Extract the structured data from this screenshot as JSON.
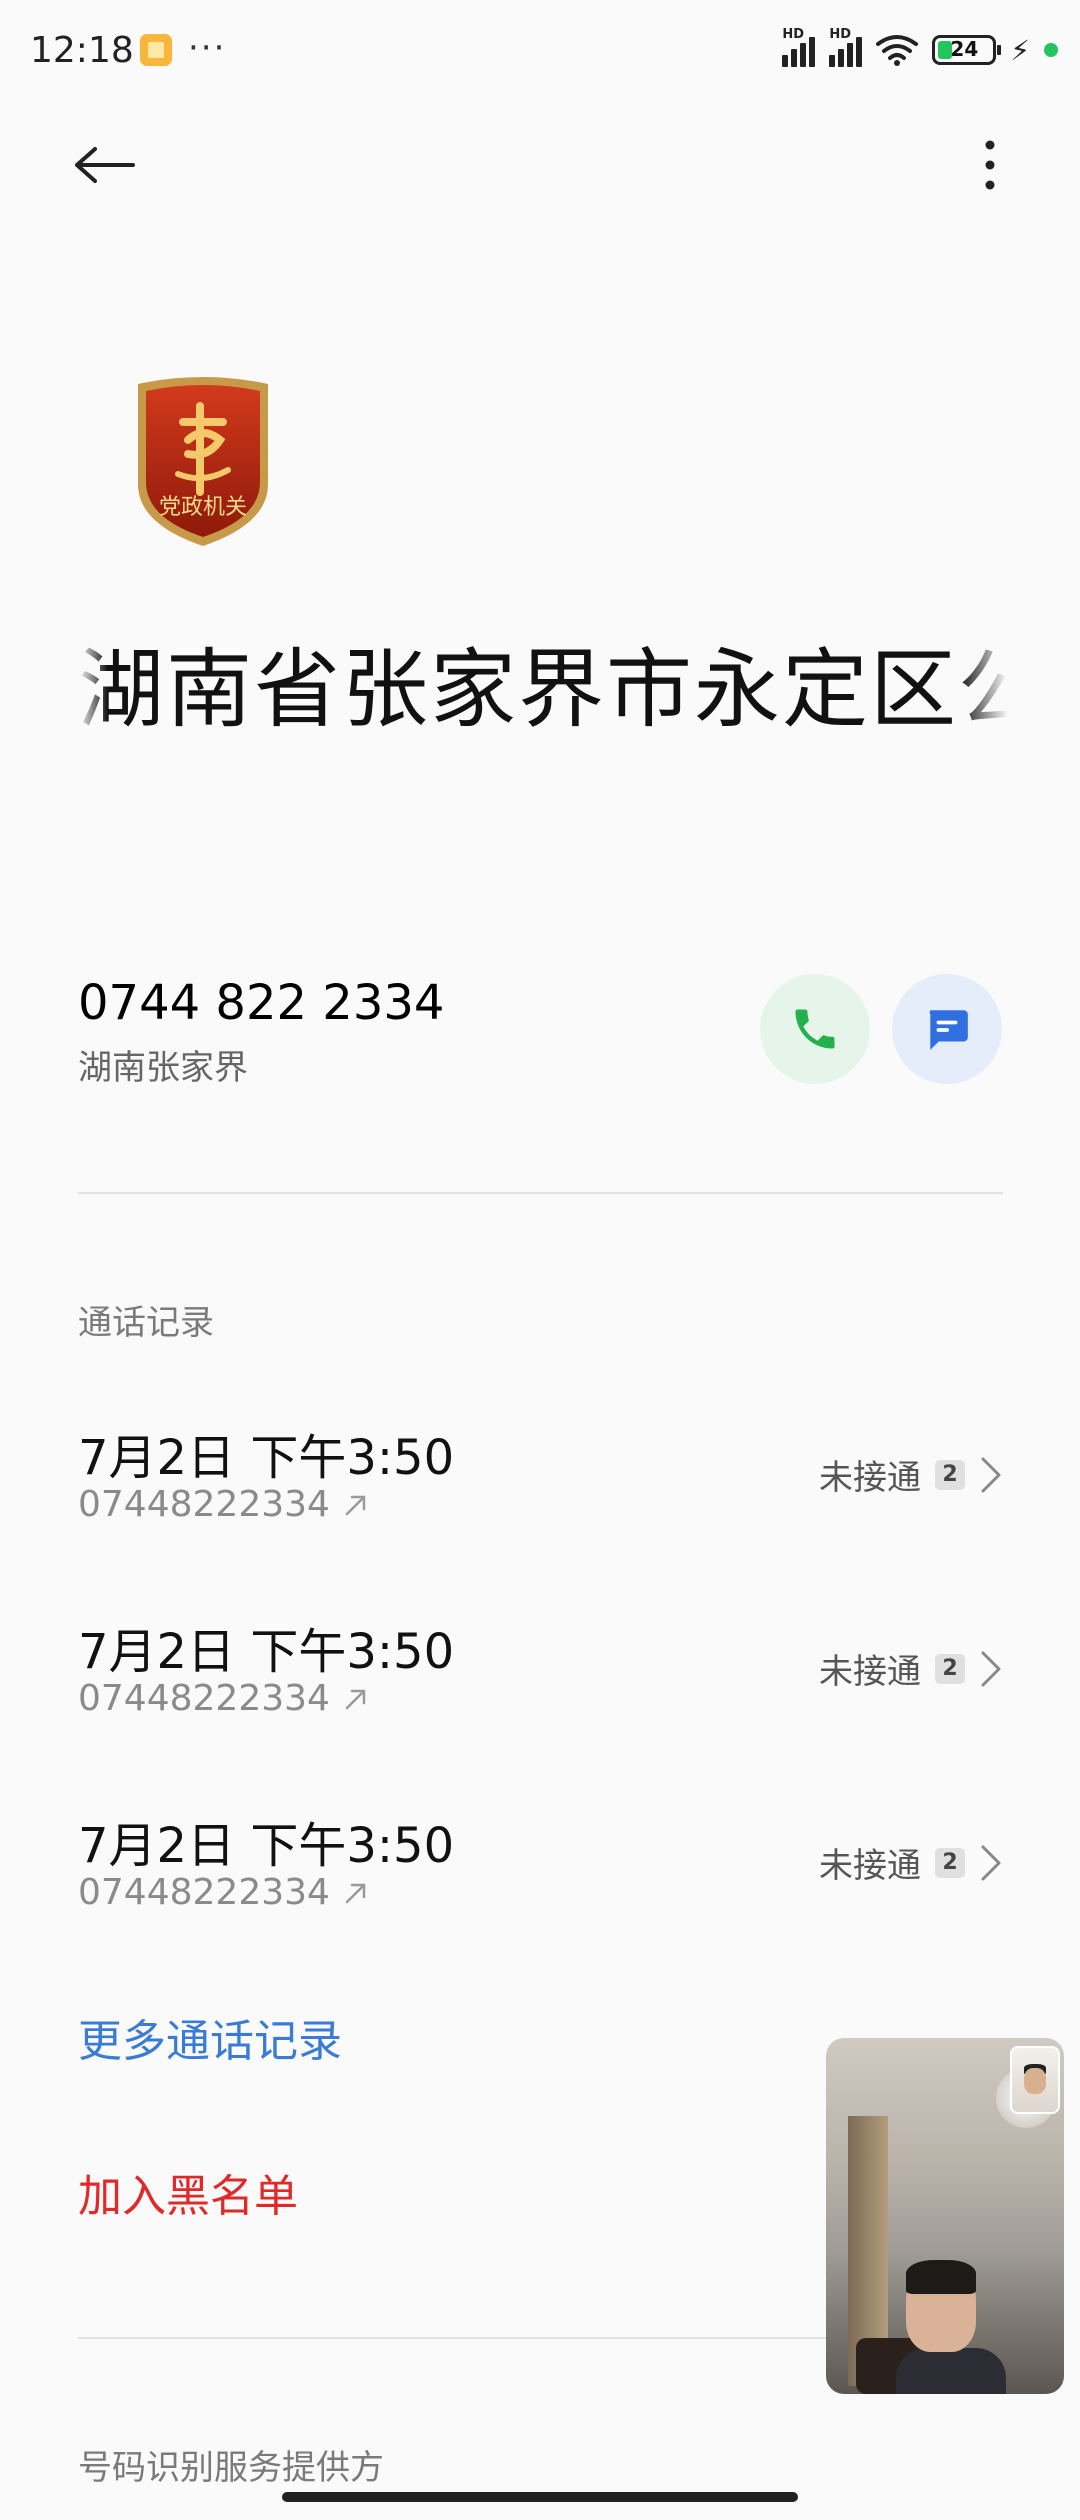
{
  "status_bar": {
    "time": "12:18",
    "dots": "···",
    "hd_label": "HD",
    "battery_level": "24"
  },
  "contact": {
    "title": "湖南省张家界市永定区公",
    "badge_text": "党政机关",
    "phone": "0744 822 2334",
    "region": "湖南张家界"
  },
  "call_log": {
    "label": "通话记录",
    "entries": [
      {
        "datetime": "7月2日 下午3:50",
        "number": "07448222334",
        "status": "未接通",
        "count": "2"
      },
      {
        "datetime": "7月2日 下午3:50",
        "number": "07448222334",
        "status": "未接通",
        "count": "2"
      },
      {
        "datetime": "7月2日 下午3:50",
        "number": "07448222334",
        "status": "未接通",
        "count": "2"
      }
    ],
    "more": "更多通话记录"
  },
  "actions": {
    "blacklist": "加入黑名单"
  },
  "footer": {
    "provider_label": "号码识别服务提供方"
  },
  "colors": {
    "call_green": "#22b14c",
    "message_blue": "#2f6fe0",
    "link_blue": "#3a7bd5",
    "danger_red": "#e02a2a"
  },
  "icons": [
    "back-arrow-icon",
    "more-vert-icon",
    "phone-icon",
    "message-icon",
    "outgoing-call-icon",
    "chevron-right-icon",
    "wifi-icon",
    "battery-icon",
    "charging-icon"
  ]
}
